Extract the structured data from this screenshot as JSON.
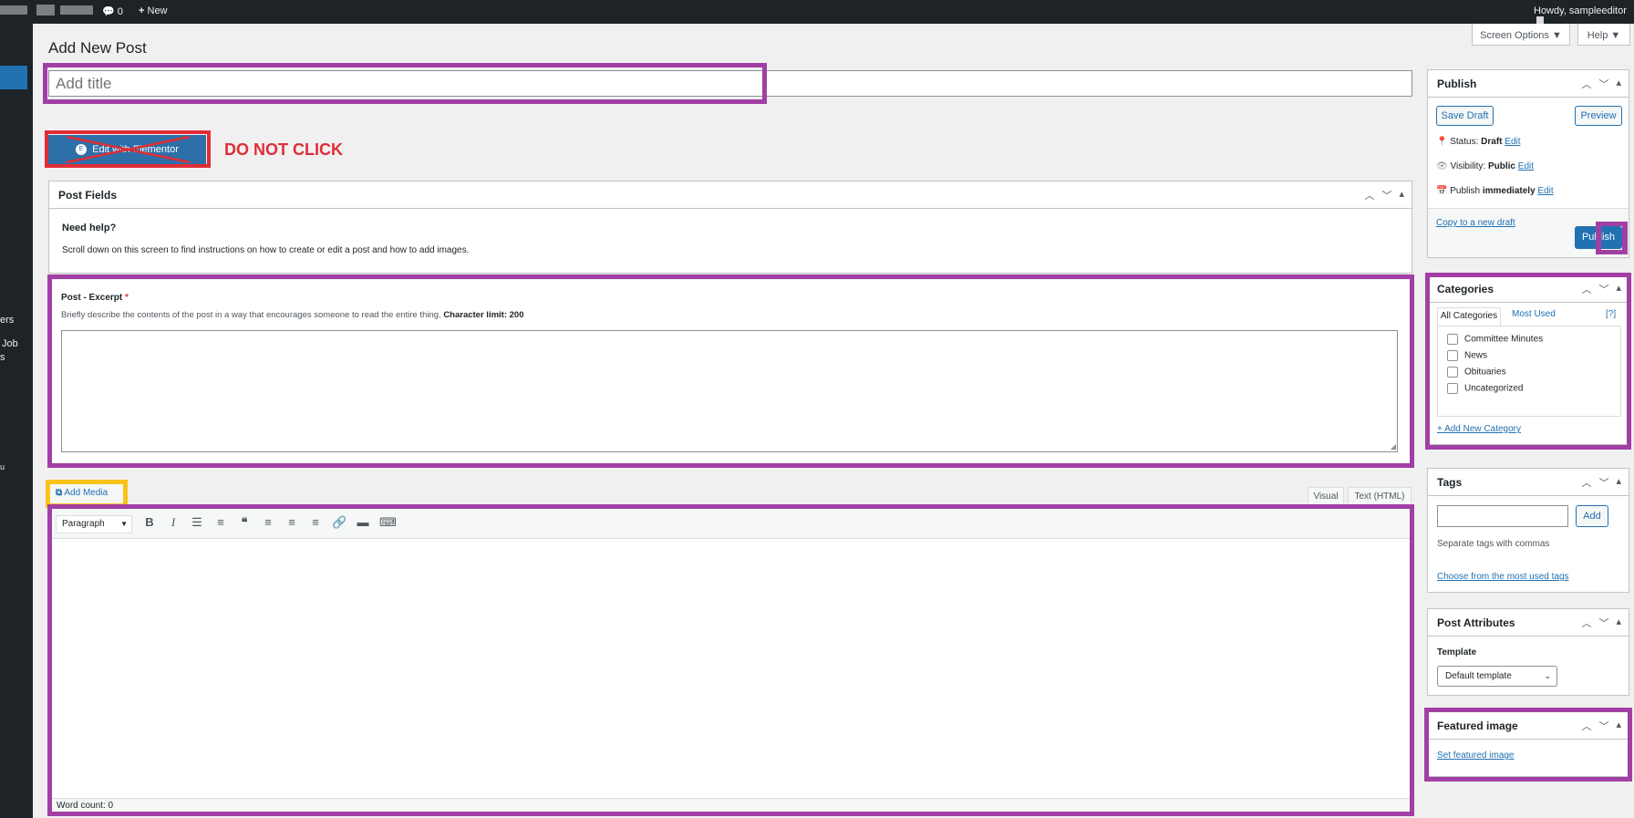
{
  "adminbar": {
    "comments_count": "0",
    "new_label": "New",
    "howdy": "Howdy, sampleeditor"
  },
  "sidebar": {
    "fragments": [
      "ers",
      "Job",
      "s",
      "u"
    ]
  },
  "page_title": "Add New Post",
  "screen_options": "Screen Options ▼",
  "help": "Help ▼",
  "title_placeholder": "Add title",
  "elementor": {
    "label": "Edit with Elementor",
    "warning": "DO NOT CLICK"
  },
  "post_fields": {
    "title": "Post Fields",
    "need_help": "Need help?",
    "help_text": "Scroll down on this screen to find instructions on how to create or edit a post and how to add images."
  },
  "excerpt": {
    "label": "Post - Excerpt",
    "required": "*",
    "desc": "Briefly describe the contents of the post in a way that encourages someone to read the entire thing.",
    "limit": "Character limit: 200"
  },
  "editor": {
    "add_media": "Add Media",
    "tab_visual": "Visual",
    "tab_text": "Text (HTML)",
    "format": "Paragraph",
    "word_count": "Word count: 0"
  },
  "publish": {
    "title": "Publish",
    "save_draft": "Save Draft",
    "preview": "Preview",
    "status_label": "Status:",
    "status_value": "Draft",
    "visibility_label": "Visibility:",
    "visibility_value": "Public",
    "publish_label": "Publish",
    "publish_value": "immediately",
    "edit": "Edit",
    "copy_draft": "Copy to a new draft",
    "publish_btn": "Publish"
  },
  "categories": {
    "title": "Categories",
    "tab_all": "All Categories",
    "tab_most": "Most Used",
    "help": "[?]",
    "items": [
      "Committee Minutes",
      "News",
      "Obituaries",
      "Uncategorized"
    ],
    "add_new": "+ Add New Category"
  },
  "tags": {
    "title": "Tags",
    "add": "Add",
    "hint": "Separate tags with commas",
    "choose": "Choose from the most used tags"
  },
  "attributes": {
    "title": "Post Attributes",
    "template_label": "Template",
    "template_value": "Default template"
  },
  "featured": {
    "title": "Featured image",
    "set": "Set featured image"
  },
  "colors": {
    "highlight_purple": "#a13fa5",
    "highlight_yellow": "#f8c419",
    "highlight_red": "#e02d36",
    "wp_blue": "#2271b1"
  }
}
